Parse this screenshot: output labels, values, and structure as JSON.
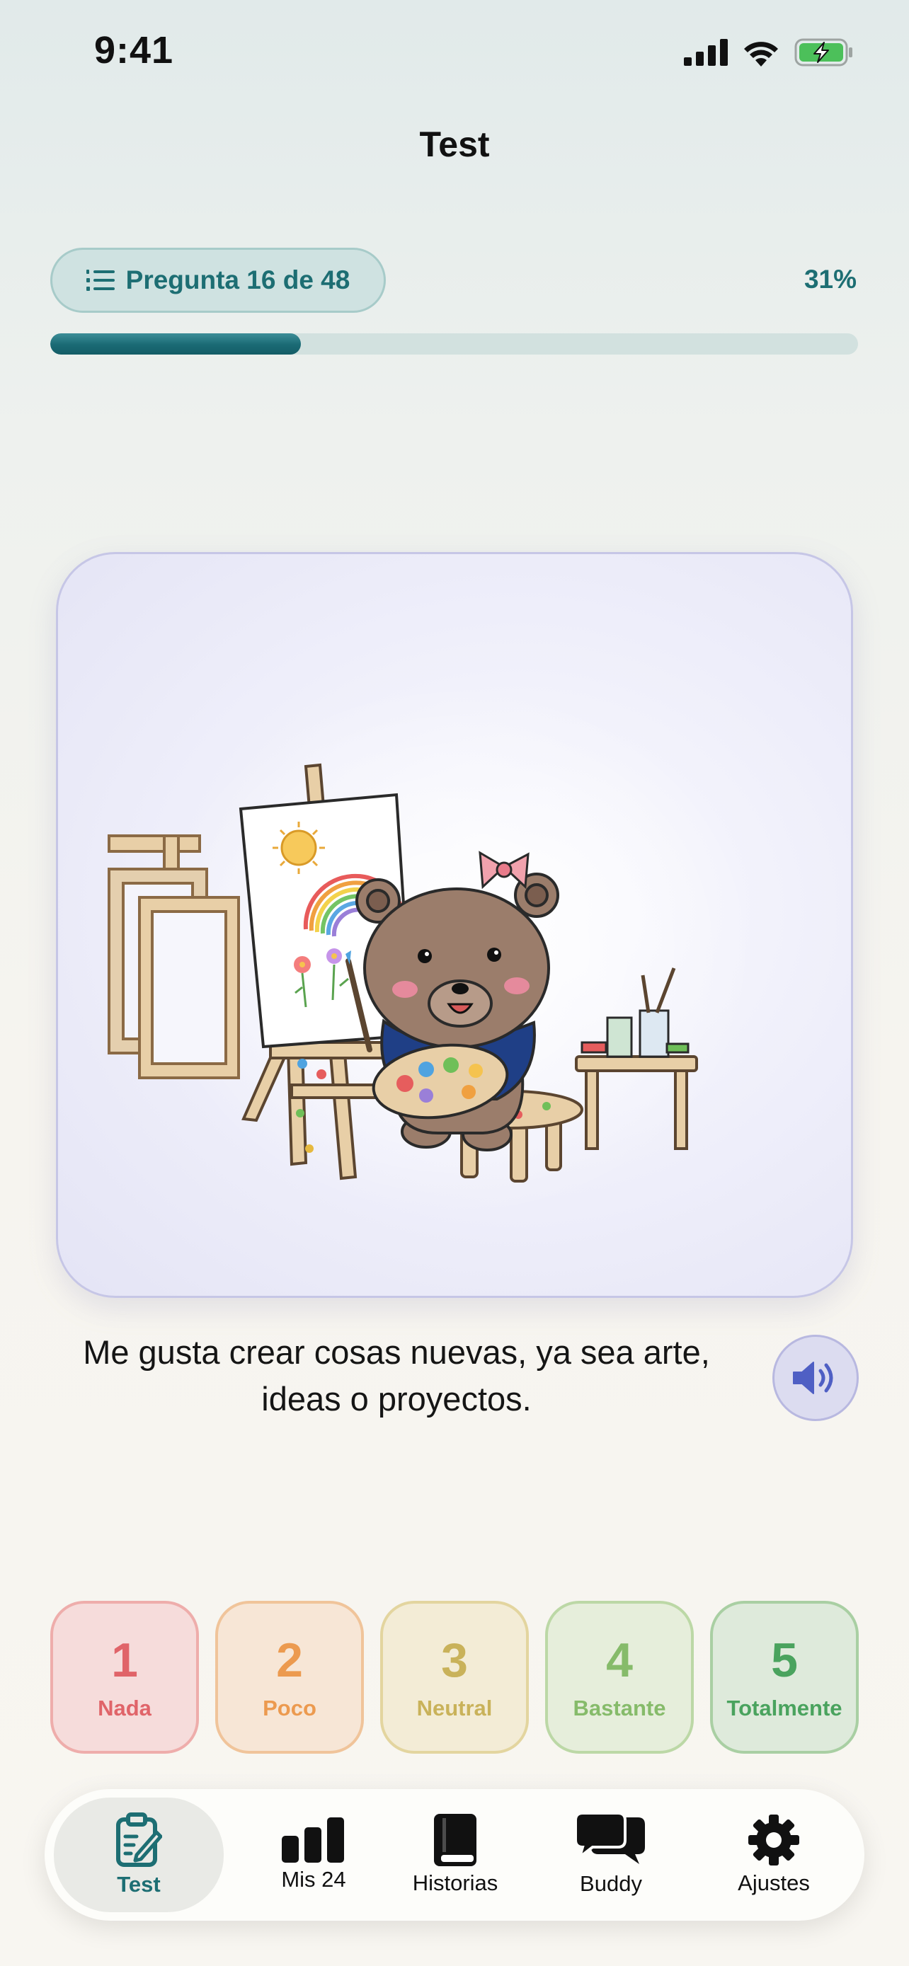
{
  "status_bar": {
    "time": "9:41"
  },
  "header": {
    "title": "Test"
  },
  "progress": {
    "question_label": "Pregunta 16 de 48",
    "percent_label": "31%",
    "fraction": 0.31
  },
  "question": {
    "text": "Me gusta crear cosas nuevas, ya sea arte, ideas o proyectos."
  },
  "answers": [
    {
      "value": "1",
      "label": "Nada"
    },
    {
      "value": "2",
      "label": "Poco"
    },
    {
      "value": "3",
      "label": "Neutral"
    },
    {
      "value": "4",
      "label": "Bastante"
    },
    {
      "value": "5",
      "label": "Totalmente"
    }
  ],
  "tabs": [
    {
      "label": "Test",
      "icon": "clipboard-pencil-icon",
      "active": true
    },
    {
      "label": "Mis 24",
      "icon": "bar-chart-icon"
    },
    {
      "label": "Historias",
      "icon": "book-icon"
    },
    {
      "label": "Buddy",
      "icon": "chat-bubbles-icon"
    },
    {
      "label": "Ajustes",
      "icon": "gear-icon"
    }
  ],
  "colors": {
    "accent": "#1d6e73",
    "answer_1": "#e06469",
    "answer_2": "#ec9a4f",
    "answer_3": "#c9b25a",
    "answer_4": "#86bb6a",
    "answer_5": "#4aa35e"
  }
}
